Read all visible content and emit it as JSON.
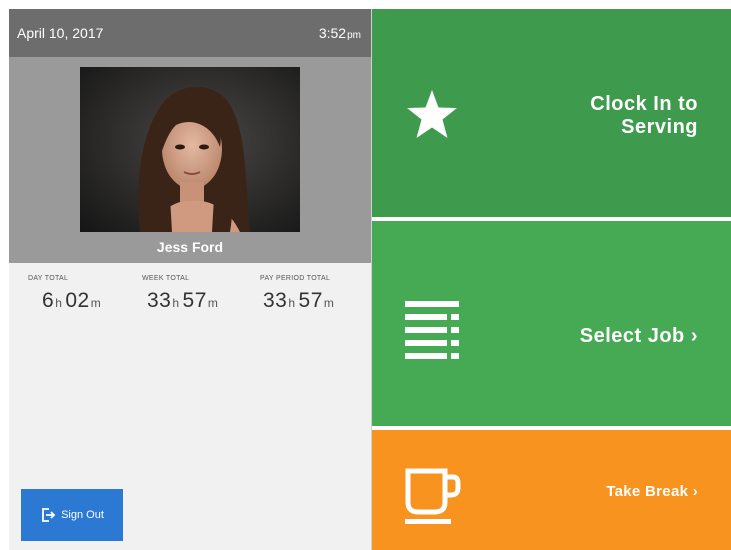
{
  "header": {
    "date": "April 10, 2017",
    "time": "3:52",
    "ampm": "pm"
  },
  "employee": {
    "name": "Jess Ford"
  },
  "totals": [
    {
      "label": "DAY TOTAL",
      "hours": "6",
      "minutes": "02",
      "h_unit": "h",
      "m_unit": "m"
    },
    {
      "label": "WEEK TOTAL",
      "hours": "33",
      "minutes": "57",
      "h_unit": "h",
      "m_unit": "m"
    },
    {
      "label": "PAY PERIOD TOTAL",
      "hours": "33",
      "minutes": "57",
      "h_unit": "h",
      "m_unit": "m"
    }
  ],
  "actions": {
    "sign_out": "Sign Out",
    "clock_in_line1": "Clock In to",
    "clock_in_line2": "Serving",
    "select_job": "Select Job ›",
    "take_break": "Take Break ›"
  },
  "icons": {
    "clock_in": "star-icon",
    "select_job": "list-icon",
    "take_break": "coffee-cup-icon",
    "sign_out": "sign-out-icon"
  },
  "colors": {
    "clock_in_tile": "#3e9a4c",
    "select_job_tile": "#46aa55",
    "take_break_tile": "#f7931e",
    "sign_out_button": "#2b79d2",
    "header_bar": "#6d6d6d"
  }
}
